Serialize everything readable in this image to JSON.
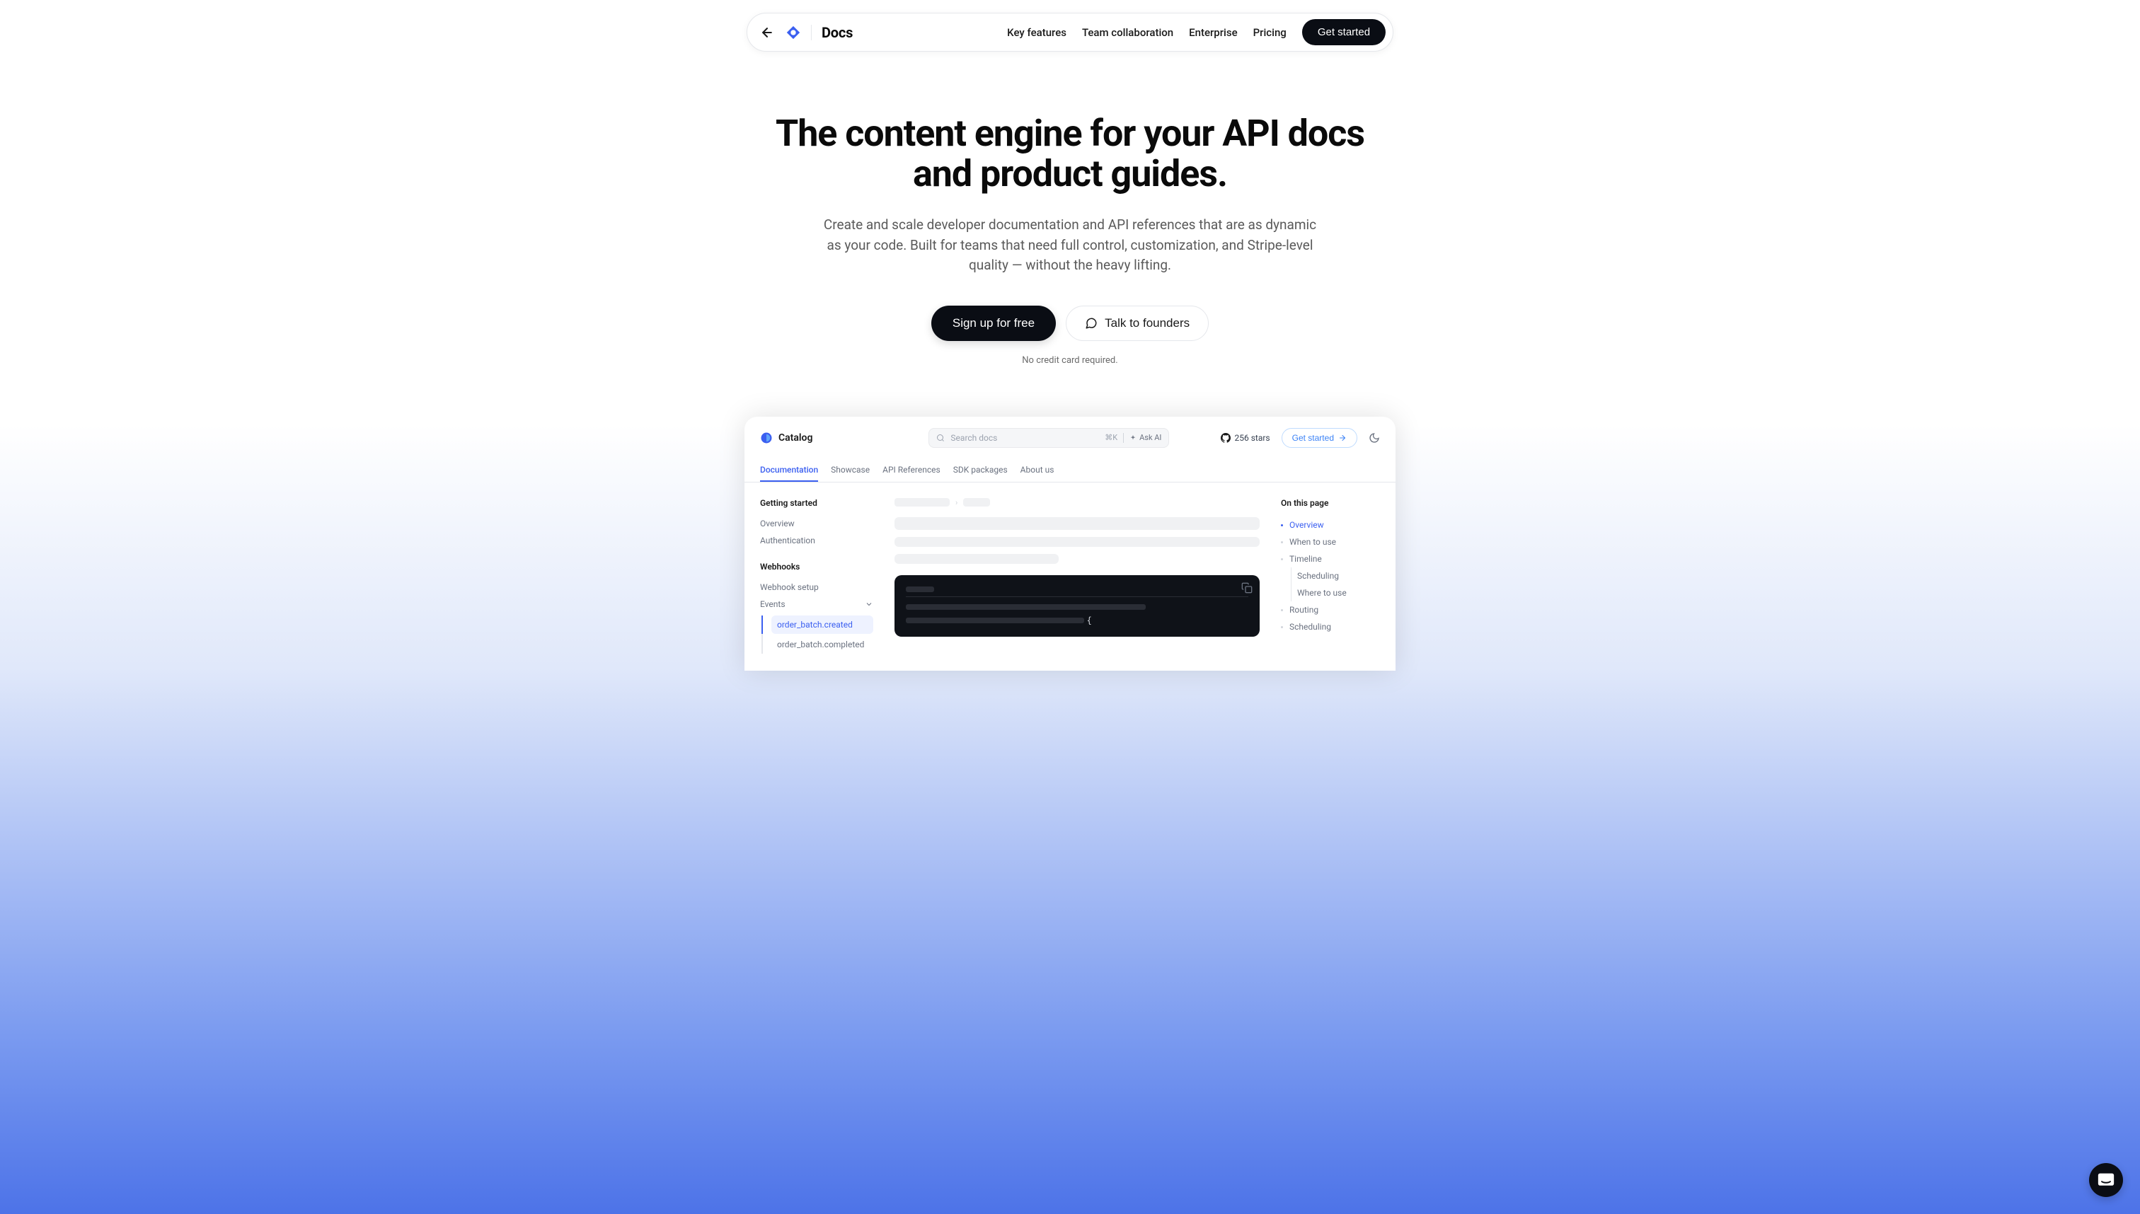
{
  "nav": {
    "brand": "Docs",
    "links": [
      "Key features",
      "Team collaboration",
      "Enterprise",
      "Pricing"
    ],
    "cta": "Get started"
  },
  "hero": {
    "title": "The content engine for your API docs and product guides.",
    "subtitle": "Create and scale developer documentation and API references that are as dynamic as your code. Built for teams that need full control, customization, and Stripe-level quality — without the heavy lifting.",
    "primary_button": "Sign up for free",
    "secondary_button": "Talk to founders",
    "note": "No credit card required."
  },
  "preview": {
    "brand": "Catalog",
    "search_placeholder": "Search docs",
    "search_kbd": "⌘K",
    "search_ai": "Ask AI",
    "stars": "256 stars",
    "cta": "Get started",
    "tabs": [
      "Documentation",
      "Showcase",
      "API References",
      "SDK packages",
      "About us"
    ],
    "sidebar": {
      "section1": "Getting started",
      "section1_items": [
        "Overview",
        "Authentication"
      ],
      "section2": "Webhooks",
      "section2_items": [
        "Webhook setup"
      ],
      "section2_expandable": "Events",
      "nested_items": [
        "order_batch.created",
        "order_batch.completed"
      ]
    },
    "code_brace": "{",
    "toc": {
      "heading": "On this page",
      "items": [
        "Overview",
        "When to use",
        "Timeline"
      ],
      "nested": [
        "Scheduling",
        "Where to use"
      ],
      "items2": [
        "Routing",
        "Scheduling"
      ]
    }
  }
}
